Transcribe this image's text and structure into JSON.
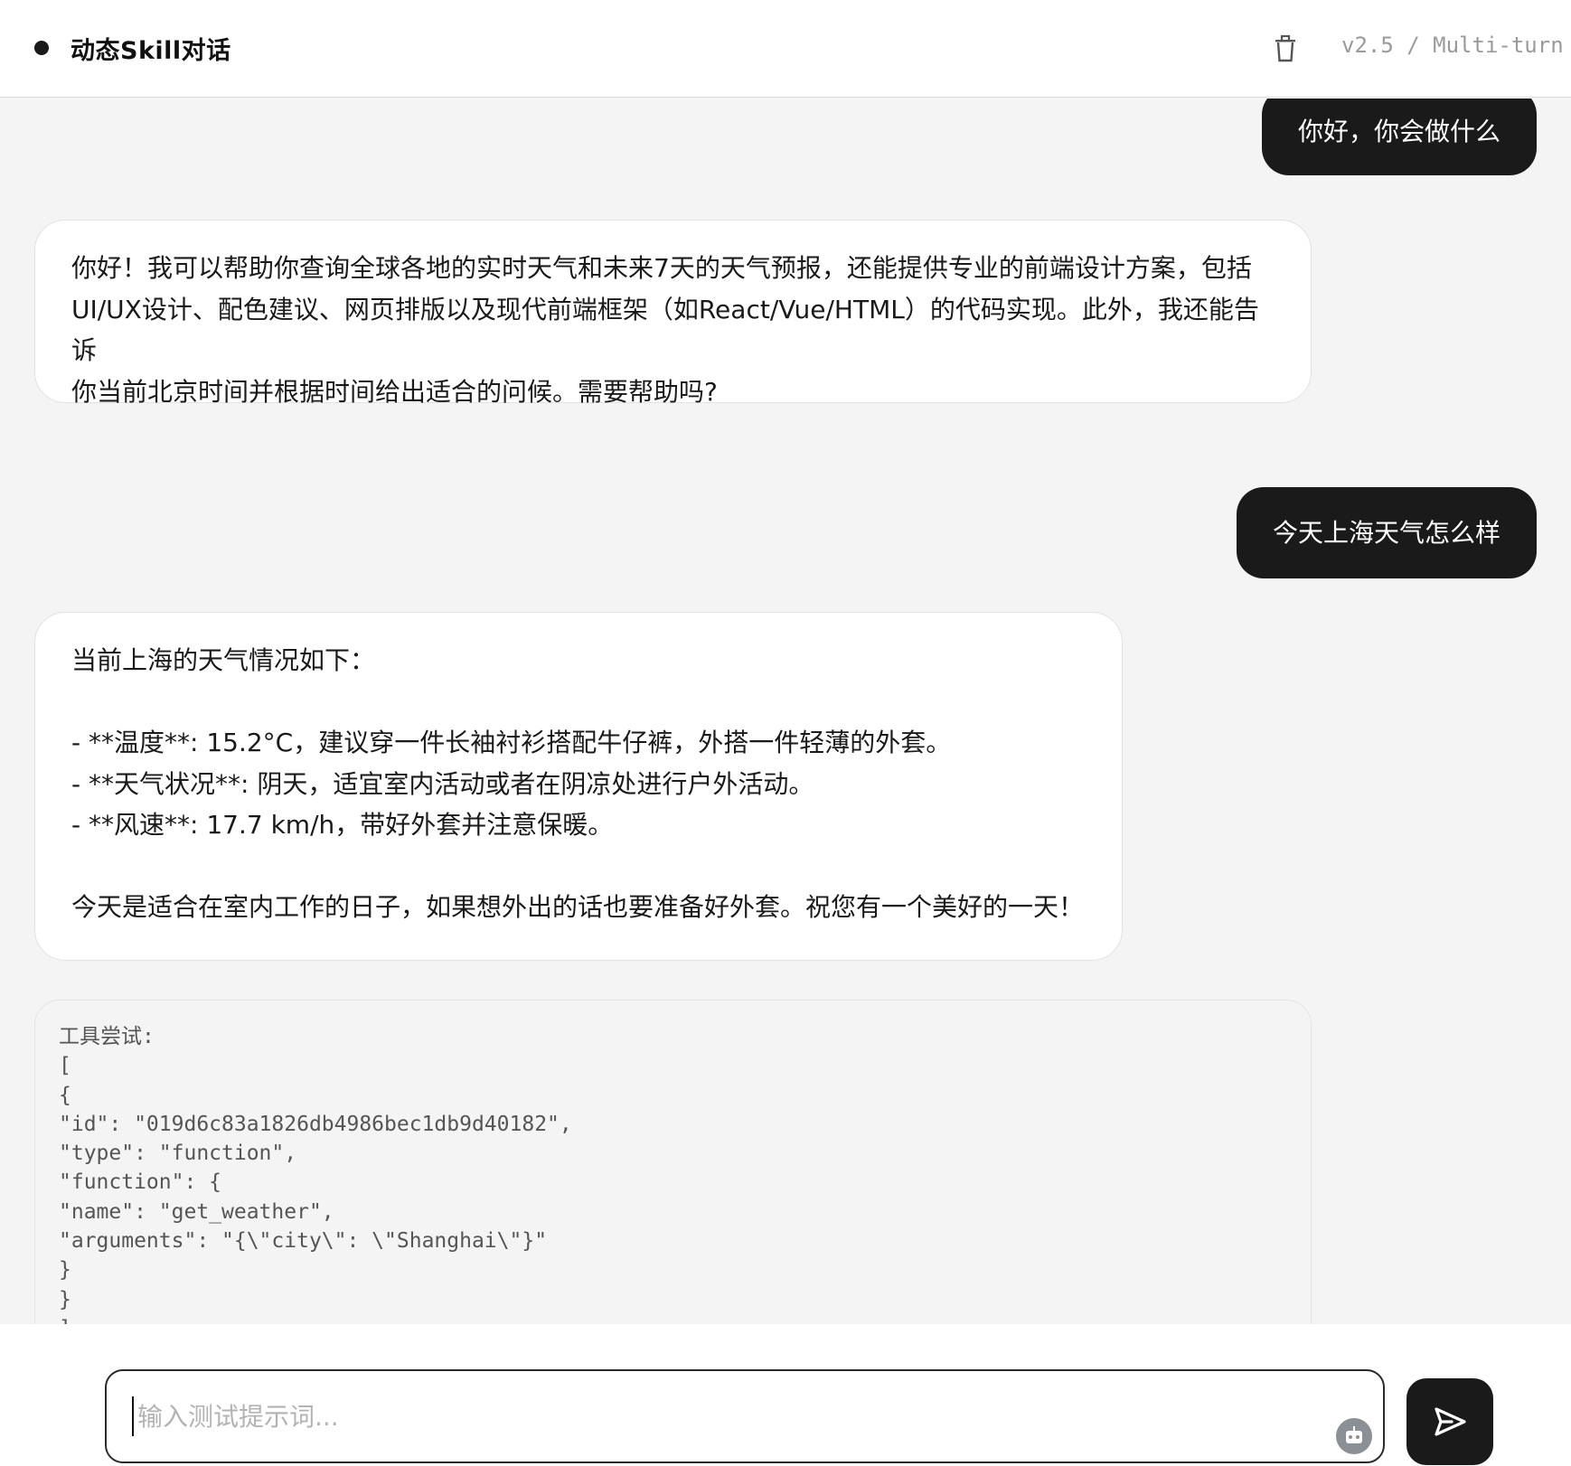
{
  "header": {
    "title": "动态Skill对话",
    "version": "v2.5 / Multi-turn",
    "clear_icon": "trash-icon"
  },
  "messages": [
    {
      "role": "user",
      "text": "你好，你会做什么"
    },
    {
      "role": "assistant",
      "text": "你好！我可以帮助你查询全球各地的实时天气和未来7天的天气预报，还能提供专业的前端设计方案，包括\nUI/UX设计、配色建议、网页排版以及现代前端框架（如React/Vue/HTML）的代码实现。此外，我还能告诉\n你当前北京时间并根据时间给出适合的问候。需要帮助吗?"
    },
    {
      "role": "user",
      "text": "今天上海天气怎么样"
    },
    {
      "role": "assistant",
      "text": "当前上海的天气情况如下：\n\n- **温度**: 15.2°C，建议穿一件长袖衬衫搭配牛仔裤，外搭一件轻薄的外套。\n- **天气状况**: 阴天，适宜室内活动或者在阴凉处进行户外活动。\n- **风速**: 17.7 km/h，带好外套并注意保暖。\n\n今天是适合在室内工作的日子，如果想外出的话也要准备好外套。祝您有一个美好的一天！"
    }
  ],
  "tool_attempt": {
    "text": "工具尝试:\n[\n{\n\"id\": \"019d6c83a1826db4986bec1db9d40182\",\n\"type\": \"function\",\n\"function\": {\n\"name\": \"get_weather\",\n\"arguments\": \"{\\\"city\\\": \\\"Shanghai\\\"}\"\n}\n}\n]"
  },
  "composer": {
    "placeholder": "输入测试提示词...",
    "value": "",
    "robot_icon": "robot-icon",
    "send_icon": "send-icon"
  }
}
